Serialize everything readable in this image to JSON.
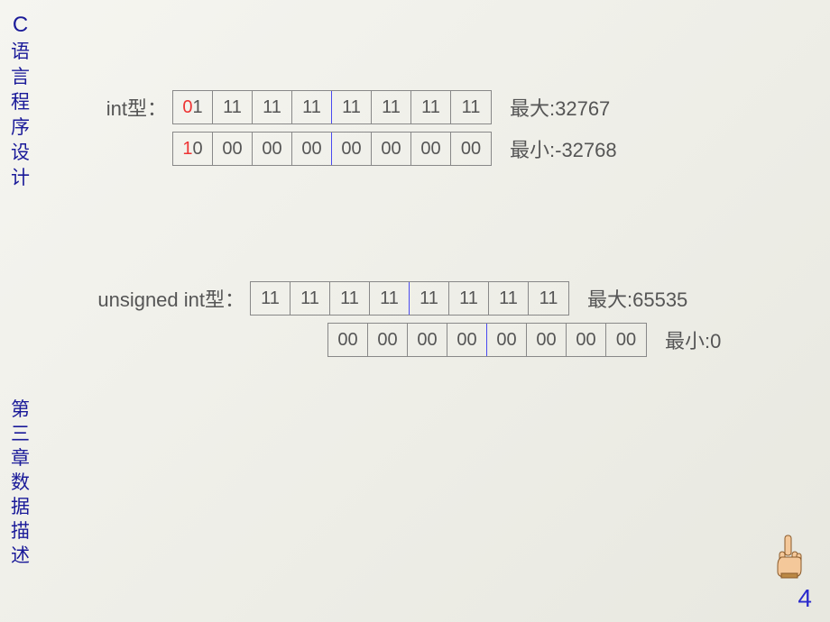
{
  "sidebar": {
    "title": "C",
    "subtitle": "语言程序设计",
    "chapter": "第三章数据描述"
  },
  "sections": {
    "int": {
      "label": "int型：",
      "rows": [
        {
          "cells": [
            {
              "sign": "0",
              "rest": "1"
            },
            {
              "v": "11"
            },
            {
              "v": "11"
            },
            {
              "v": "11"
            },
            {
              "v": "11"
            },
            {
              "v": "11"
            },
            {
              "v": "11"
            },
            {
              "v": "11"
            }
          ],
          "post": "最大:32767"
        },
        {
          "cells": [
            {
              "sign": "1",
              "rest": "0"
            },
            {
              "v": "00"
            },
            {
              "v": "00"
            },
            {
              "v": "00"
            },
            {
              "v": "00"
            },
            {
              "v": "00"
            },
            {
              "v": "00"
            },
            {
              "v": "00"
            }
          ],
          "post": "最小:-32768"
        }
      ]
    },
    "uint": {
      "label": "unsigned int型：",
      "rows": [
        {
          "cells": [
            {
              "v": "11"
            },
            {
              "v": "11"
            },
            {
              "v": "11"
            },
            {
              "v": "11"
            },
            {
              "v": "11"
            },
            {
              "v": "11"
            },
            {
              "v": "11"
            },
            {
              "v": "11"
            }
          ],
          "post": "最大:65535"
        },
        {
          "cells": [
            {
              "v": "00"
            },
            {
              "v": "00"
            },
            {
              "v": "00"
            },
            {
              "v": "00"
            },
            {
              "v": "00"
            },
            {
              "v": "00"
            },
            {
              "v": "00"
            },
            {
              "v": "00"
            }
          ],
          "post": "最小:0"
        }
      ]
    }
  },
  "page_number": "4"
}
